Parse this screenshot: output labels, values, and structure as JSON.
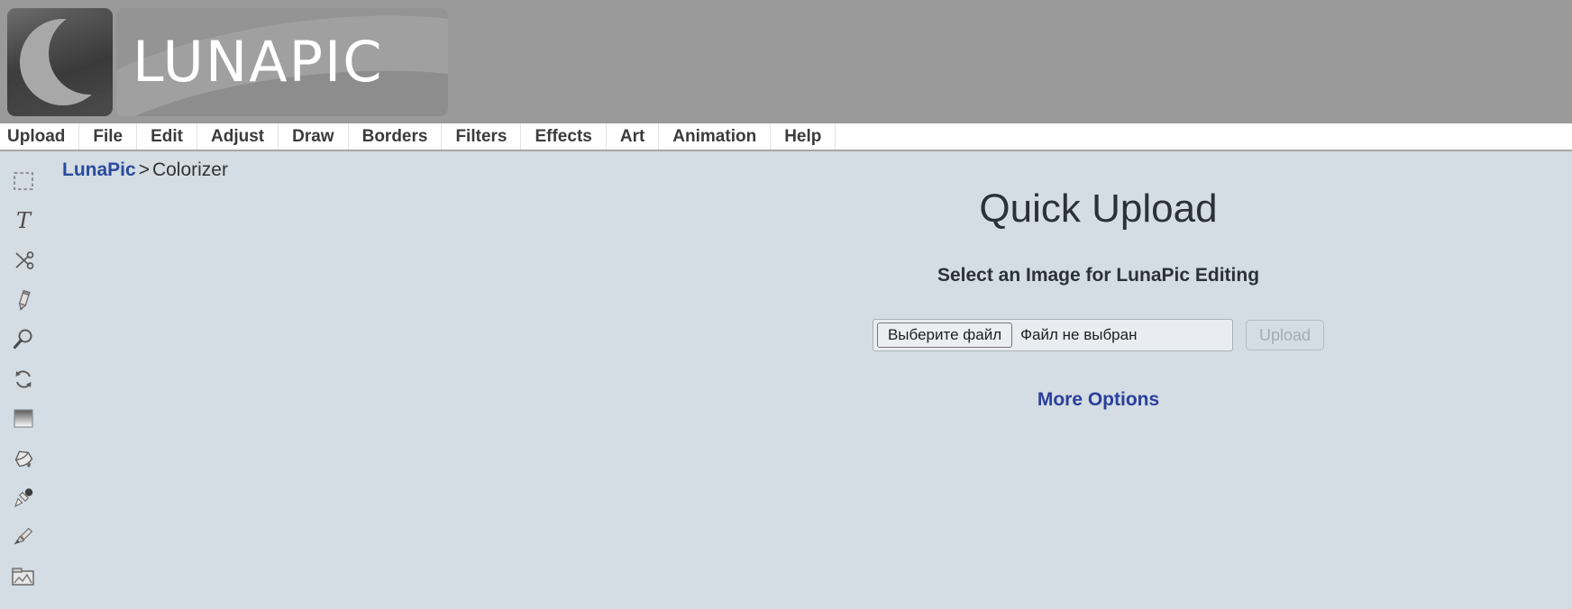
{
  "header": {
    "logo_wordmark": "LUNAPIC",
    "logo_alt": "lunapic-logo"
  },
  "menubar": {
    "items": [
      {
        "label": "Upload",
        "name": "menu-upload"
      },
      {
        "label": "File",
        "name": "menu-file"
      },
      {
        "label": "Edit",
        "name": "menu-edit"
      },
      {
        "label": "Adjust",
        "name": "menu-adjust"
      },
      {
        "label": "Draw",
        "name": "menu-draw"
      },
      {
        "label": "Borders",
        "name": "menu-borders"
      },
      {
        "label": "Filters",
        "name": "menu-filters"
      },
      {
        "label": "Effects",
        "name": "menu-effects"
      },
      {
        "label": "Art",
        "name": "menu-art"
      },
      {
        "label": "Animation",
        "name": "menu-animation"
      },
      {
        "label": "Help",
        "name": "menu-help"
      }
    ]
  },
  "toolbar": {
    "tools": [
      {
        "icon": "selection-marquee-icon",
        "title": "Selection"
      },
      {
        "icon": "text-tool-icon",
        "title": "Text"
      },
      {
        "icon": "scissors-icon",
        "title": "Cut"
      },
      {
        "icon": "pencil-icon",
        "title": "Pencil"
      },
      {
        "icon": "magnifier-icon",
        "title": "Zoom"
      },
      {
        "icon": "rotate-icon",
        "title": "Rotate"
      },
      {
        "icon": "gradient-icon",
        "title": "Gradient"
      },
      {
        "icon": "paint-bucket-icon",
        "title": "Fill"
      },
      {
        "icon": "eyedropper-icon",
        "title": "Color Picker"
      },
      {
        "icon": "paintbrush-icon",
        "title": "Brush"
      },
      {
        "icon": "frame-icon",
        "title": "Frame"
      }
    ]
  },
  "breadcrumb": {
    "root": "LunaPic",
    "separator": ">",
    "current": "Colorizer"
  },
  "main": {
    "title": "Quick Upload",
    "subtitle": "Select an Image for LunaPic Editing",
    "file_input": {
      "button_label": "Выберите файл",
      "status_text": "Файл не выбран"
    },
    "upload_button_label": "Upload",
    "more_options_label": "More Options"
  },
  "colors": {
    "page_background": "#d4dce4",
    "header_band": "#9a9a9a",
    "menubar_background": "#ffffff",
    "link_blue": "#2a3f9b",
    "text_dark": "#2b3138"
  }
}
